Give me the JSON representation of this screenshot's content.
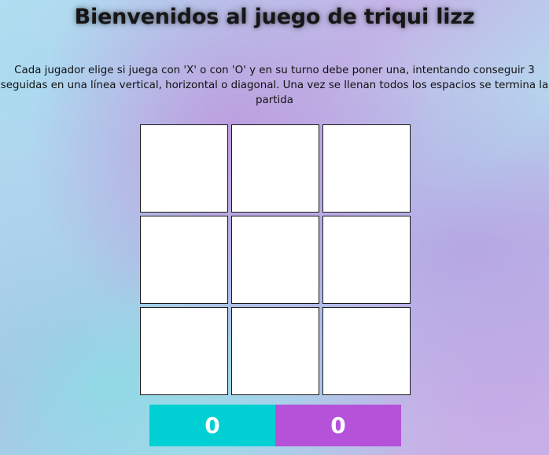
{
  "header": {
    "title": "Bienvenidos al juego de triqui lizz",
    "description": "Cada jugador elige si juega con 'X' o con 'O' y en su turno debe poner una, intentando conseguir 3 seguidas en una línea vertical, horizontal o diagonal. Una vez se llenan todos los espacios se termina la partida"
  },
  "board": {
    "cells": [
      "",
      "",
      "",
      "",
      "",
      "",
      "",
      "",
      ""
    ]
  },
  "scoreboard": {
    "player_x_score": "0",
    "player_o_score": "0",
    "player_x_color": "#00cfd4",
    "player_o_color": "#b552d9"
  }
}
